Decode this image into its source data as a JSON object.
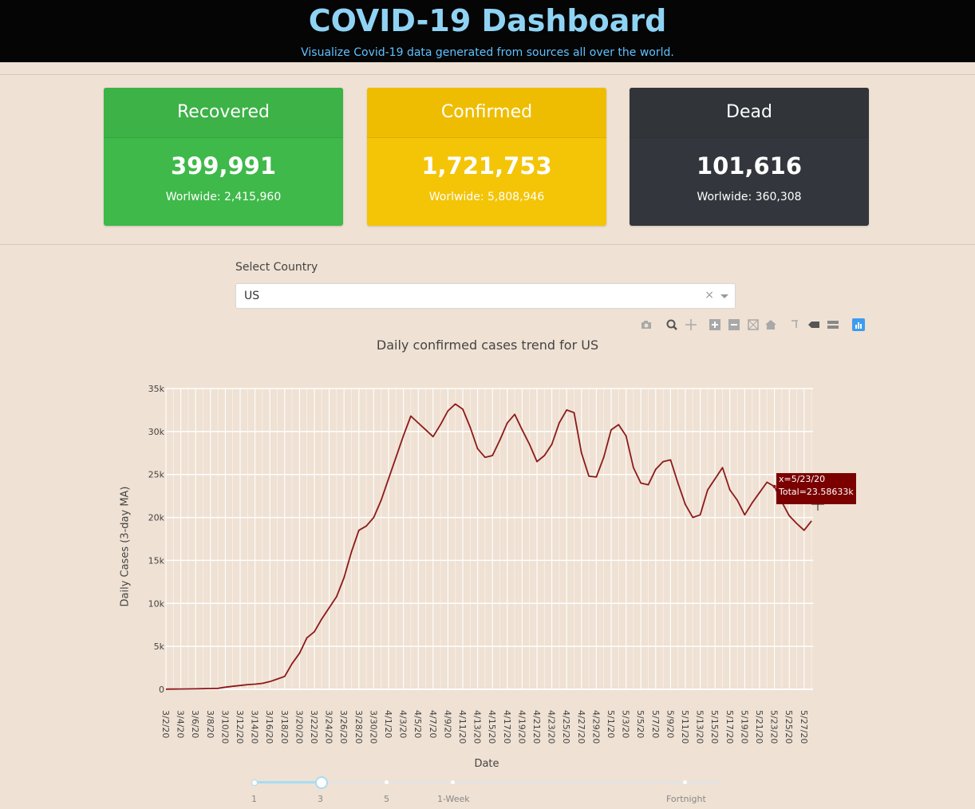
{
  "header": {
    "title": "COVID-19 Dashboard",
    "subtitle": "Visualize Covid-19 data generated from sources all over the world."
  },
  "cards": {
    "recovered": {
      "title": "Recovered",
      "value": "399,991",
      "worldwide": "Worlwide: 2,415,960",
      "color": "#3fb94a"
    },
    "confirmed": {
      "title": "Confirmed",
      "value": "1,721,753",
      "worldwide": "Worlwide: 5,808,946",
      "color": "#f4c407"
    },
    "dead": {
      "title": "Dead",
      "value": "101,616",
      "worldwide": "Worlwide: 360,308",
      "color": "#33373d"
    }
  },
  "country_select": {
    "label": "Select Country",
    "value": "US",
    "clear": "×"
  },
  "modebar": [
    "camera-icon",
    "zoom-icon",
    "pan-icon",
    "zoom-in-icon",
    "zoom-out-icon",
    "autoscale-icon",
    "reset-axes-icon",
    "spike-lines-icon",
    "hover-closest-icon",
    "hover-compare-icon",
    "plotly-logo-icon"
  ],
  "hover": {
    "x_text": "x=5/23/20",
    "total_text": "Total=23.58633k"
  },
  "slider": {
    "labels": [
      "1",
      "3",
      "5",
      "1-Week",
      "Fortnight"
    ],
    "selected": "3"
  },
  "chart_data": {
    "type": "line",
    "title": "Daily confirmed cases trend for US",
    "xlabel": "Date",
    "ylabel": "Daily Cases (3-day MA)",
    "ylim": [
      0,
      35000
    ],
    "yticks": [
      "0",
      "5k",
      "10k",
      "15k",
      "20k",
      "25k",
      "30k",
      "35k"
    ],
    "line_color": "#8b1a1a",
    "grid": true,
    "x": [
      "3/2/20",
      "3/3/20",
      "3/4/20",
      "3/5/20",
      "3/6/20",
      "3/7/20",
      "3/8/20",
      "3/9/20",
      "3/10/20",
      "3/11/20",
      "3/12/20",
      "3/13/20",
      "3/14/20",
      "3/15/20",
      "3/16/20",
      "3/17/20",
      "3/18/20",
      "3/19/20",
      "3/20/20",
      "3/21/20",
      "3/22/20",
      "3/23/20",
      "3/24/20",
      "3/25/20",
      "3/26/20",
      "3/27/20",
      "3/28/20",
      "3/29/20",
      "3/30/20",
      "3/31/20",
      "4/1/20",
      "4/2/20",
      "4/3/20",
      "4/4/20",
      "4/5/20",
      "4/6/20",
      "4/7/20",
      "4/8/20",
      "4/9/20",
      "4/10/20",
      "4/11/20",
      "4/12/20",
      "4/13/20",
      "4/14/20",
      "4/15/20",
      "4/16/20",
      "4/17/20",
      "4/18/20",
      "4/19/20",
      "4/20/20",
      "4/21/20",
      "4/22/20",
      "4/23/20",
      "4/24/20",
      "4/25/20",
      "4/26/20",
      "4/27/20",
      "4/28/20",
      "4/29/20",
      "4/30/20",
      "5/1/20",
      "5/2/20",
      "5/3/20",
      "5/4/20",
      "5/5/20",
      "5/6/20",
      "5/7/20",
      "5/8/20",
      "5/9/20",
      "5/10/20",
      "5/11/20",
      "5/12/20",
      "5/13/20",
      "5/14/20",
      "5/15/20",
      "5/16/20",
      "5/17/20",
      "5/18/20",
      "5/19/20",
      "5/20/20",
      "5/21/20",
      "5/22/20",
      "5/23/20",
      "5/24/20",
      "5/25/20",
      "5/26/20",
      "5/27/20",
      "5/28/20"
    ],
    "values": [
      20,
      30,
      40,
      50,
      60,
      70,
      90,
      110,
      250,
      350,
      450,
      550,
      600,
      700,
      900,
      1200,
      1500,
      3000,
      4200,
      6000,
      6700,
      8200,
      9500,
      10800,
      13000,
      16000,
      18500,
      19000,
      20000,
      22000,
      24500,
      27000,
      29500,
      31800,
      31000,
      30200,
      29400,
      30800,
      32400,
      33200,
      32600,
      30500,
      28000,
      27000,
      27200,
      29000,
      31000,
      32000,
      30200,
      28500,
      26500,
      27200,
      28500,
      31000,
      32500,
      32200,
      27500,
      24800,
      24700,
      27000,
      30200,
      30800,
      29500,
      25800,
      24000,
      23800,
      25600,
      26500,
      26700,
      24000,
      21500,
      20000,
      20300,
      23200,
      24500,
      25800,
      23200,
      22000,
      20300,
      21700,
      22900,
      24100,
      23600,
      21800,
      20200,
      19300,
      18500,
      19600
    ]
  }
}
